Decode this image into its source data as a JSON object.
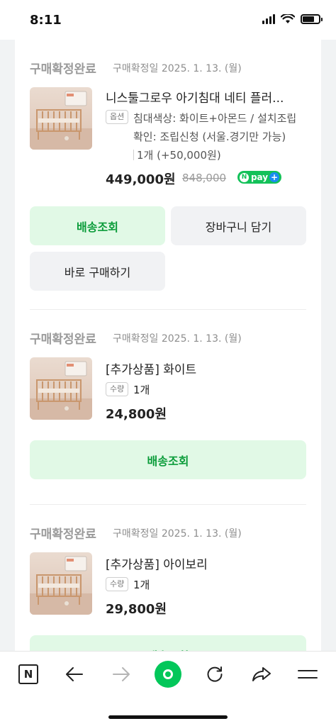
{
  "status_bar": {
    "time": "8:11"
  },
  "orders": [
    {
      "status": "구매확정완료",
      "date": "구매확정일 2025. 1. 13. (월)",
      "title": "니스툴그로우 아기침대 네티 플러...",
      "option_badge": "옵션",
      "option_line1": "침대색상: 화이트+아몬드 / 설치조립",
      "option_line2": "확인: 조립신청 (서울.경기만 가능)",
      "option_line3": "1개 (+50,000원)",
      "price": "449,000원",
      "original_price": "848,000",
      "npay_label": "pay",
      "buttons": [
        "배송조회",
        "장바구니 담기",
        "바로 구매하기"
      ]
    },
    {
      "status": "구매확정완료",
      "date": "구매확정일 2025. 1. 13. (월)",
      "title": "[추가상품] 화이트",
      "qty_badge": "수량",
      "qty": "1개",
      "price": "24,800원",
      "buttons": [
        "배송조회"
      ]
    },
    {
      "status": "구매확정완료",
      "date": "구매확정일 2025. 1. 13. (월)",
      "title": "[추가상품] 아이보리",
      "qty_badge": "수량",
      "qty": "1개",
      "price": "29,800원",
      "buttons": [
        "배송조회"
      ]
    }
  ],
  "colors": {
    "green_button_bg": "#e1f9e6",
    "green_text": "#0b9c3a",
    "npay": "#13c159",
    "browser_accent": "#03c75a"
  },
  "bottom_bar": {
    "icons": [
      "naver-n-icon",
      "back-arrow-icon",
      "forward-arrow-icon",
      "green-dot-home-icon",
      "reload-icon",
      "share-icon",
      "menu-icon"
    ],
    "naver_letter": "N"
  }
}
